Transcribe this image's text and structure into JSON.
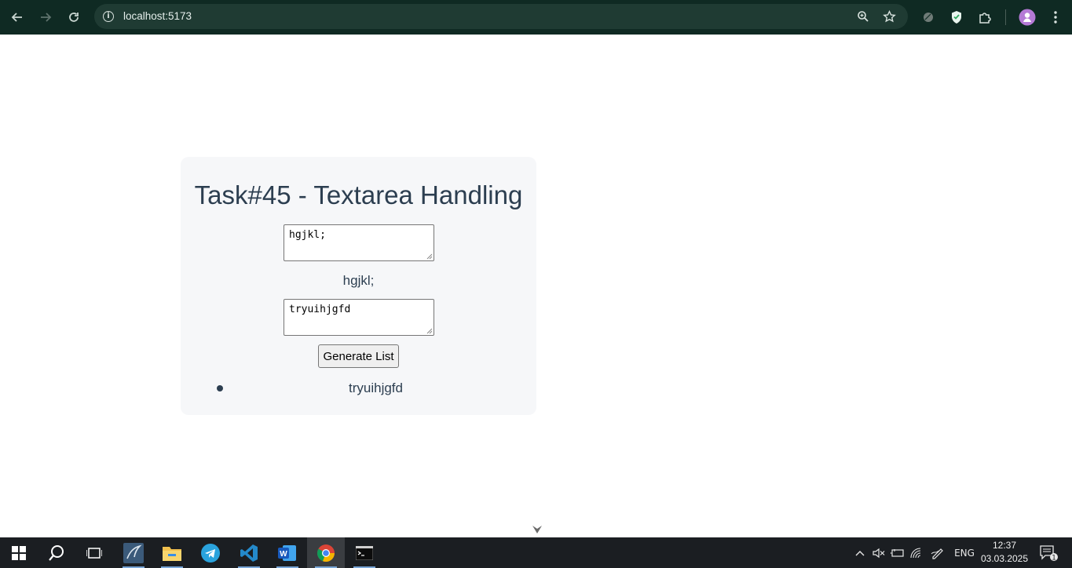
{
  "browser": {
    "url": "localhost:5173",
    "nav": {
      "back": "back-arrow",
      "forward": "forward-arrow",
      "reload": "reload"
    },
    "omnibox_icons": [
      "zoom-icon",
      "bookmark-star-icon"
    ],
    "extensions": [
      "extension-grey-icon",
      "adguard-shield-icon",
      "puzzle-extensions-icon"
    ],
    "profile": "profile-avatar",
    "menu": "kebab-menu-icon"
  },
  "page": {
    "title": "Task#45 - Textarea Handling",
    "textarea1_value": "hgjkl;",
    "echo_text": "hgjkl;",
    "textarea2_value": "tryuihjgfd",
    "button_label": "Generate List",
    "list_items": [
      "tryuihjgfd"
    ]
  },
  "taskbar": {
    "apps": [
      "start",
      "search",
      "task-view",
      "mysql-workbench",
      "file-explorer",
      "telegram",
      "vscode",
      "word",
      "chrome",
      "terminal"
    ],
    "active_app": "chrome",
    "tray": {
      "language": "ENG",
      "time": "12:37",
      "date": "03.03.2025",
      "notification_count": "1"
    }
  },
  "colors": {
    "toolbar_bg": "#0f2a23",
    "omnibox_bg": "#1f3b33",
    "card_bg": "#f6f7f9",
    "text": "#2c3e50",
    "taskbar_bg": "#1b1e22"
  }
}
